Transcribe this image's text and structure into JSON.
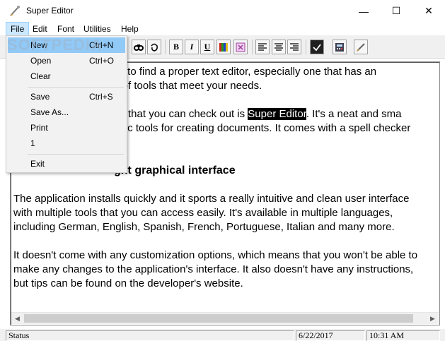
{
  "window": {
    "title": "Super Editor",
    "minimize_glyph": "—",
    "maximize_glyph": "☐",
    "close_glyph": "✕"
  },
  "menubar": {
    "items": [
      "File",
      "Edit",
      "Font",
      "Utilities",
      "Help"
    ],
    "active": "File"
  },
  "file_menu": {
    "items": [
      {
        "label": "New",
        "shortcut": "Ctrl+N"
      },
      {
        "label": "Open",
        "shortcut": "Ctrl+O"
      },
      {
        "label": "Clear",
        "shortcut": ""
      },
      {
        "label": "Save",
        "shortcut": "Ctrl+S"
      },
      {
        "label": "Save As...",
        "shortcut": ""
      },
      {
        "label": "Print",
        "shortcut": ""
      },
      {
        "label": "1",
        "shortcut": ""
      },
      {
        "label": "Exit",
        "shortcut": ""
      }
    ],
    "highlighted": "New"
  },
  "toolbar": {
    "bold_label": "B",
    "italic_label": "I",
    "underline_label": "U",
    "icons": [
      "find-icon",
      "spell-check-icon",
      "bold-icon",
      "italic-icon",
      "underline-icon",
      "color-icon",
      "highlight-icon",
      "align-left-icon",
      "align-center-icon",
      "align-right-icon",
      "checkmark-icon",
      "calculator-icon",
      "brush-icon"
    ]
  },
  "document": {
    "line1": "sk to find a proper text editor, especially one that has an",
    "line2": "s of tools that meet your needs.",
    "line3_pre": "ns that you can check out is ",
    "line3_highlight": "Super Editor",
    "line3_post": ". It's a neat and sma",
    "line4": "asic tools for creating documents. It comes with a spell checker",
    "heading": "ght graphical interface",
    "para2": [
      "The application installs quickly and it sports a really intuitive and clean user interface",
      "with multiple tools that you can access easily. It's available in multiple languages,",
      "including German, English, Spanish, French, Portuguese, Italian and many more."
    ],
    "para3": [
      "It doesn't come with any customization options, which means that you won't be able to",
      "make any changes to the application's interface. It also doesn't have any instructions,",
      "but tips can be found on the developer's website."
    ]
  },
  "statusbar": {
    "status": "Status",
    "date": "6/22/2017",
    "time": "10:31 AM"
  },
  "watermark": "SOFTPEDIA",
  "colors": {
    "menu_active_bg": "#cce8ff",
    "menu_hover_bg": "#91c9f7",
    "selection_bg": "#000000"
  }
}
